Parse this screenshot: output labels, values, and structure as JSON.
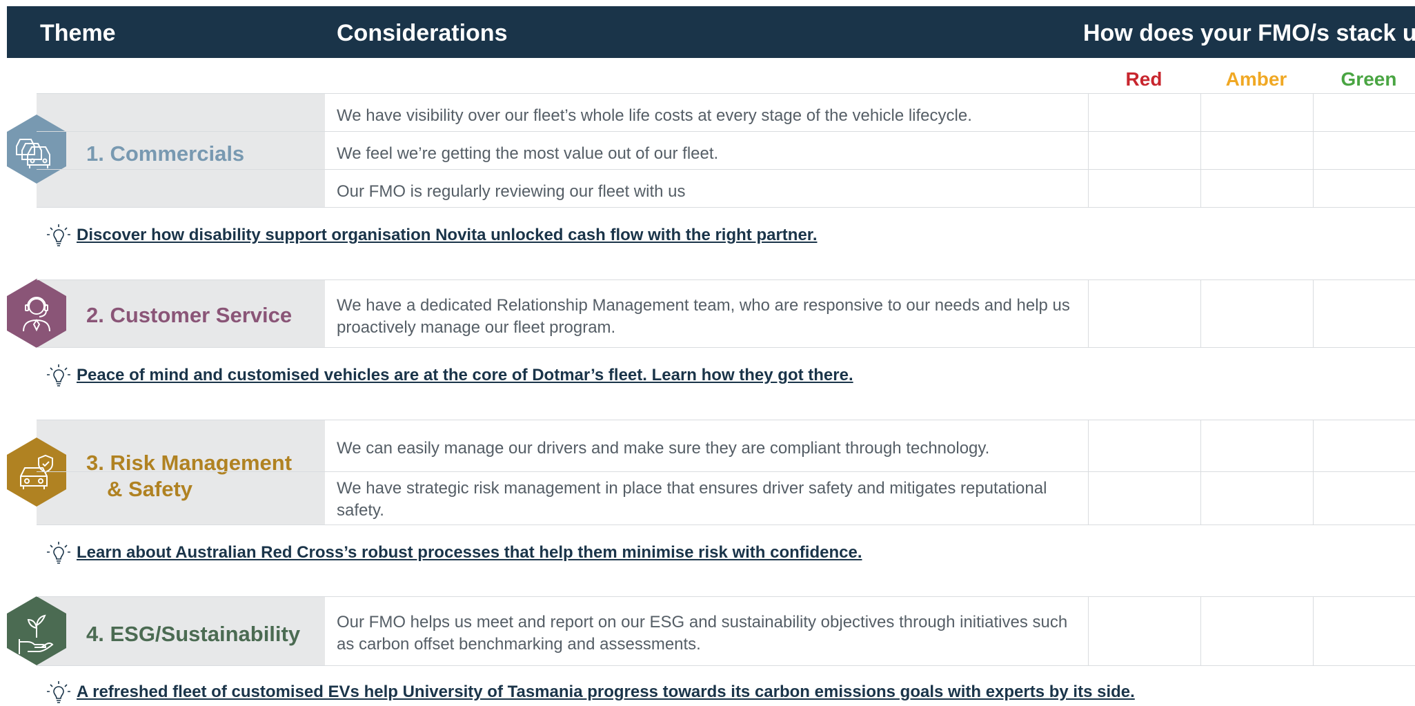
{
  "header": {
    "theme": "Theme",
    "considerations": "Considerations",
    "stack_up": "How does your FMO/s stack up?"
  },
  "rag": {
    "red": "Red",
    "amber": "Amber",
    "green": "Green"
  },
  "colors": {
    "header_bg": "#1a3449",
    "red": "#c8262e",
    "amber": "#f0a824",
    "green": "#4aa543",
    "commercials": "#7899b1",
    "customer_service": "#8a5577",
    "risk": "#b08222",
    "esg": "#4b6b52"
  },
  "themes": [
    {
      "label": "1. Commercials",
      "icon": "cars-icon",
      "considerations": [
        "We have visibility over our fleet’s whole life costs at every stage of the vehicle lifecycle.",
        "We feel we’re getting the most value out of our fleet.",
        "Our FMO is regularly reviewing our fleet with us"
      ],
      "tip": "Discover how disability support organisation Novita unlocked cash flow with the right partner."
    },
    {
      "label": "2. Customer Service",
      "icon": "headset-agent-icon",
      "considerations": [
        "We have a dedicated Relationship Management team, who are responsive to our needs and help us proactively manage our fleet program."
      ],
      "tip": "Peace of mind and customised vehicles are at the core of Dotmar’s fleet. Learn how they got there."
    },
    {
      "label_line1": "3. Risk Management",
      "label_line2": "& Safety",
      "icon": "car-shield-icon",
      "considerations": [
        "We can easily manage our drivers and make sure they are compliant through technology.",
        "We have strategic risk management in place that ensures driver safety and mitigates reputational safety."
      ],
      "tip": "Learn about Australian Red Cross’s robust processes that help them minimise risk with confidence."
    },
    {
      "label": "4. ESG/Sustainability",
      "icon": "plant-hand-icon",
      "considerations": [
        "Our FMO helps us meet and report on our ESG and sustainability objectives through initiatives such as carbon offset benchmarking and assessments."
      ],
      "tip": "A refreshed fleet of customised EVs help University of Tasmania progress towards its carbon emissions goals with experts by its side."
    }
  ]
}
